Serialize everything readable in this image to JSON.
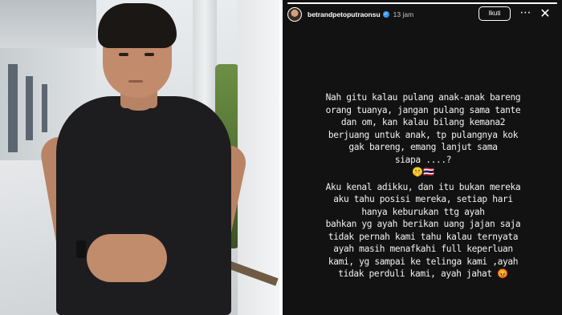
{
  "story": {
    "username": "betrandpetoputraonsu",
    "verified_glyph": "✓",
    "timestamp": "13 jam",
    "follow_label": "Ikuti",
    "more_glyph": "⋯",
    "close_glyph": "✕",
    "progress": 1.0,
    "paragraph_1": [
      "Nah gitu kalau pulang anak-anak bareng",
      "orang tuanya, jangan pulang sama tante",
      "dan om, kan kalau bilang kemana2",
      "berjuang untuk anak, tp pulangnya kok",
      "gak bareng, emang lanjut sama",
      "siapa ....?",
      "🤫🇹🇭"
    ],
    "paragraph_2": [
      "Aku kenal adikku, dan itu bukan mereka",
      "aku tahu posisi mereka, setiap hari",
      "hanya keburukan ttg ayah",
      "bahkan yg ayah berikan uang jajan saja",
      "tidak pernah kami tahu kalau ternyata",
      "ayah masih menafkahi full keperluan",
      "kami, yg sampai ke telinga kami ,ayah",
      "tidak perduli kami, ayah jahat 😡"
    ]
  },
  "colors": {
    "story_background": "#121212",
    "text": "#f2f2f2",
    "verified": "#3897f0"
  },
  "icons": [
    "verified-icon",
    "more-icon",
    "close-icon"
  ]
}
